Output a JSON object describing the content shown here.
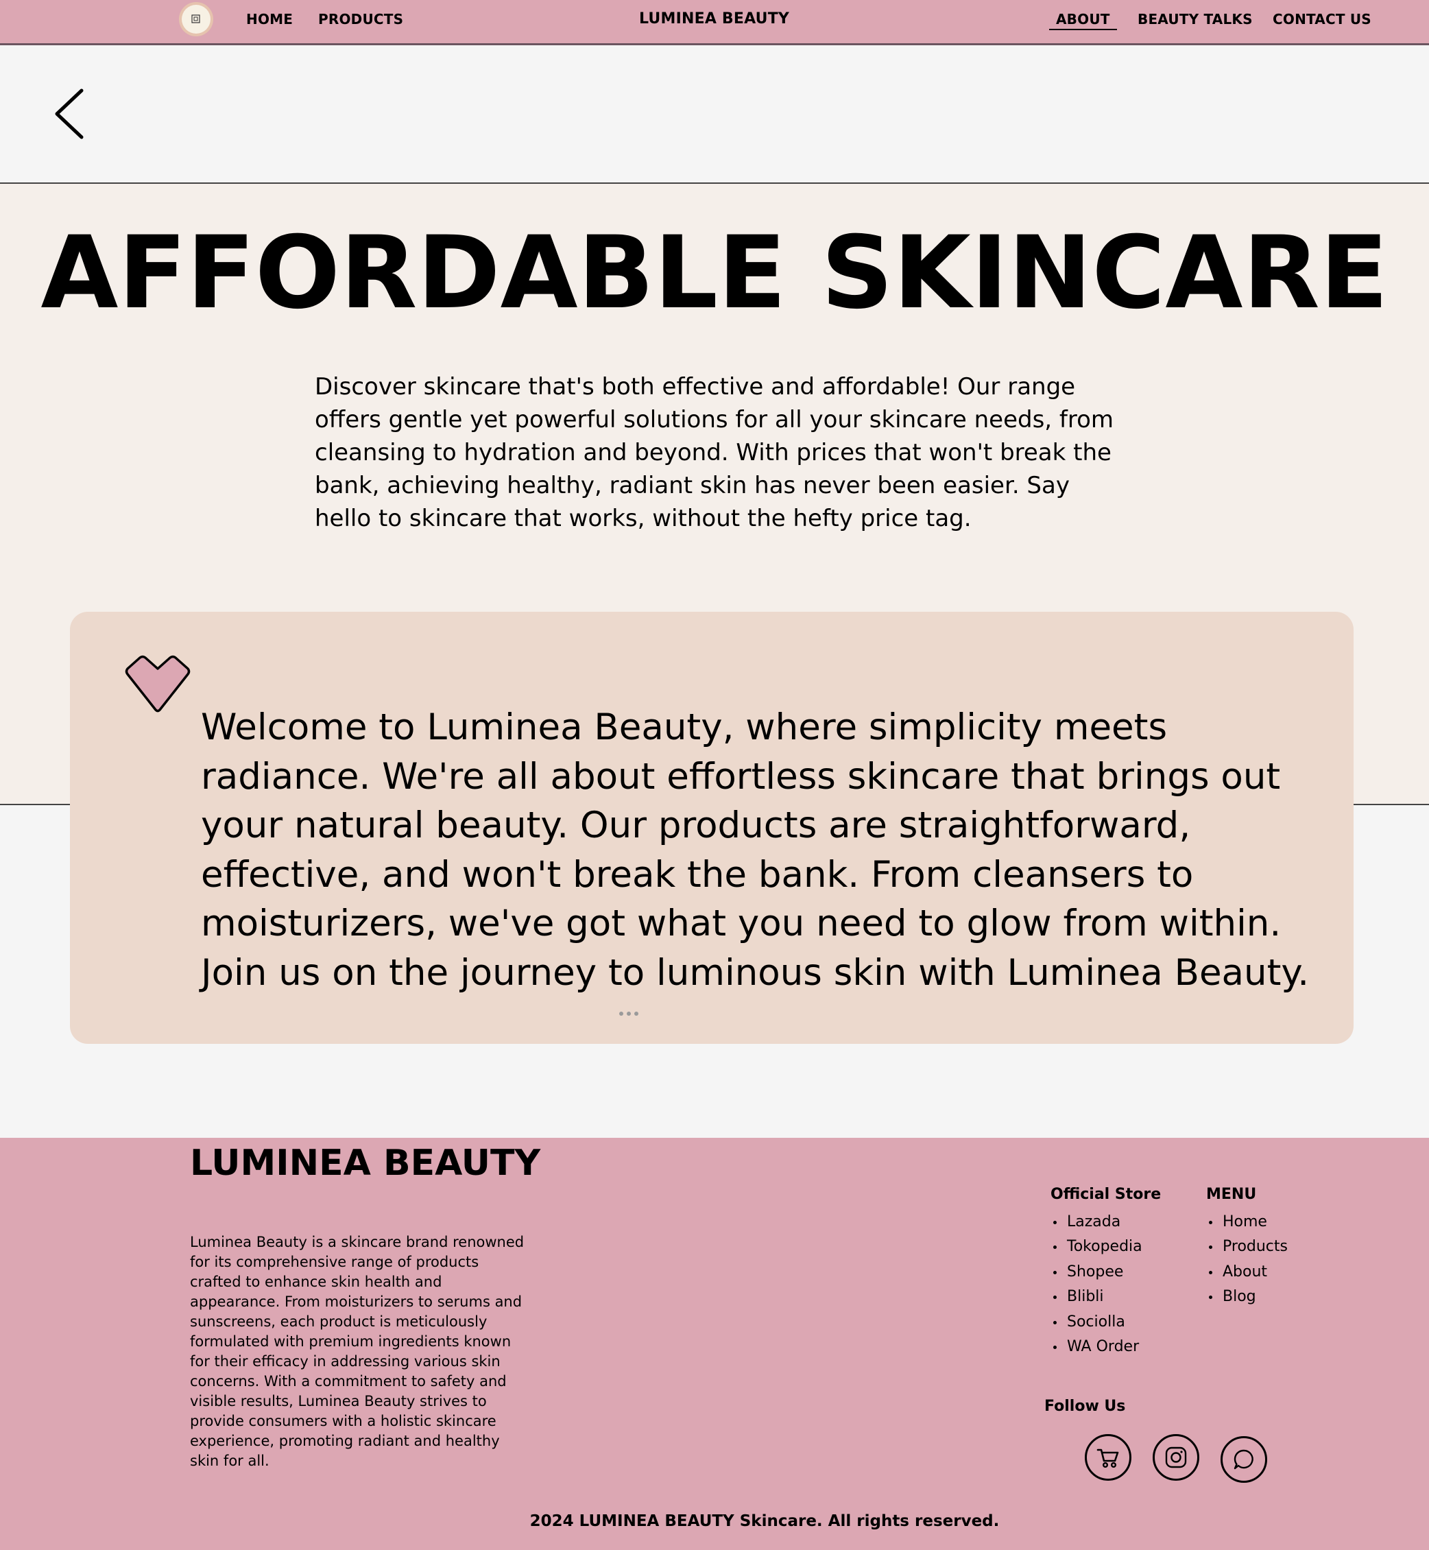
{
  "nav": {
    "left_links": [
      "HOME",
      "PRODUCTS"
    ],
    "brand": "LUMINEA BEAUTY",
    "right_links": [
      "ABOUT",
      "BEAUTY TALKS",
      "CONTACT US"
    ],
    "active": "ABOUT"
  },
  "hero": {
    "title": "AFFORDABLE SKINCARE",
    "description": "Discover skincare that's both effective and affordable! Our range offers gentle yet powerful solutions for all your skincare needs, from cleansing to hydration and beyond. With prices that won't break the bank, achieving healthy, radiant skin has never been easier. Say hello to skincare that works, without the hefty price tag."
  },
  "welcome": {
    "text": "Welcome to Luminea Beauty, where simplicity meets radiance. We're all about effortless skincare that brings out your natural beauty. Our products are straightforward, effective, and won't break the bank. From cleansers to moisturizers, we've got what you need to glow from within. Join us on the journey to luminous skin with Luminea Beauty."
  },
  "footer": {
    "brand": "LUMINEA BEAUTY",
    "description": "Luminea Beauty is a skincare brand renowned for its comprehensive range of products crafted to enhance skin health and appearance. From moisturizers to serums and sunscreens, each product is meticulously formulated with premium ingredients known for their efficacy in addressing various skin concerns. With a commitment to safety and visible results, Luminea Beauty strives to provide consumers with a holistic skincare experience, promoting radiant and healthy skin for all.",
    "store_heading": "Official Store",
    "stores": [
      "Lazada",
      "Tokopedia",
      "Shopee",
      "Blibli",
      "Sociolla",
      "WA Order"
    ],
    "menu_heading": "MENU",
    "menu": [
      "Home",
      "Products",
      "About",
      "Blog"
    ],
    "follow_heading": "Follow Us",
    "social_icons": [
      "shopping-cart-icon",
      "instagram-icon",
      "whatsapp-icon"
    ],
    "copyright": "2024 LUMINEA BEAUTY Skincare. All rights reserved."
  },
  "colors": {
    "nav_bg": "#dca7b3",
    "hero_bg": "#f5efea",
    "card_bg": "#ecd9cd",
    "page_bg": "#f5f5f5",
    "heart": "#dca7b3"
  }
}
